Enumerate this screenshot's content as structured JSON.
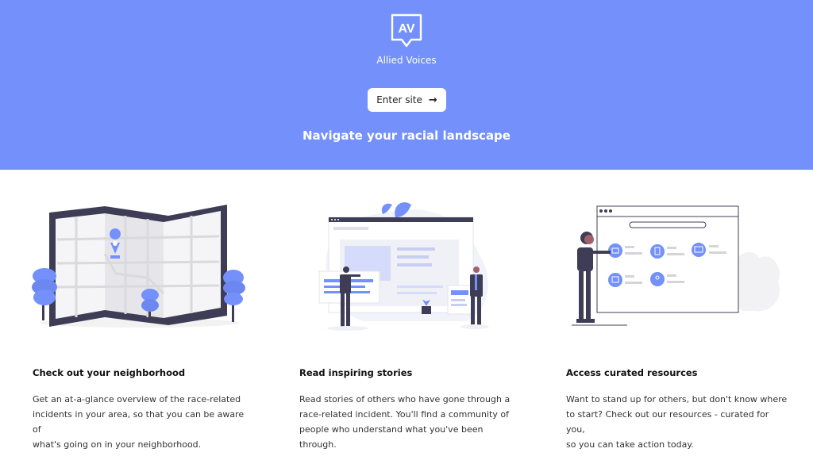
{
  "brand": {
    "logo_text": "AV",
    "name": "Allied Voices"
  },
  "hero": {
    "enter_label": "Enter site",
    "enter_icon": "arrow-right-icon",
    "tagline": "Navigate your racial landscape",
    "bg_color": "#7390fb"
  },
  "features": [
    {
      "illustration": "map-icon",
      "title": "Check out your neighborhood",
      "lines": [
        "Get an at-a-glance overview of the race-related",
        "incidents in your area, so that you can be aware of",
        "what's going on in your neighborhood."
      ]
    },
    {
      "illustration": "stories-icon",
      "title": "Read inspiring stories",
      "lines": [
        "Read stories of others who have gone through a",
        "race-related incident. You'll find  a community of",
        "people who understand what you've been through."
      ]
    },
    {
      "illustration": "resources-icon",
      "title": "Access curated resources",
      "lines": [
        "Want to stand up for others, but don't know where",
        "to start? Check out our resources - curated for you,",
        "so you can take action today."
      ]
    }
  ],
  "colors": {
    "accent": "#7390fb",
    "dark": "#3f3d56"
  }
}
